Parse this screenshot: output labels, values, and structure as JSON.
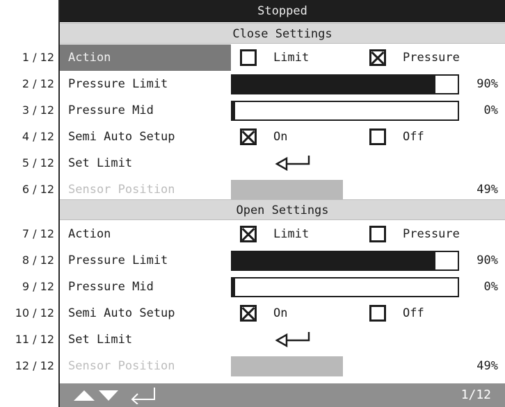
{
  "status": "Stopped",
  "close_section": {
    "title": "Close Settings",
    "rows": [
      {
        "num": "1 / 12",
        "label": "Action",
        "opt1": "Limit",
        "opt1_checked": false,
        "opt2": "Pressure",
        "opt2_checked": true
      },
      {
        "num": "2 / 12",
        "label": "Pressure Limit",
        "value": 90,
        "value_text": "90%"
      },
      {
        "num": "3 / 12",
        "label": "Pressure Mid",
        "value": 0,
        "value_text": "0%"
      },
      {
        "num": "4 / 12",
        "label": "Semi Auto Setup",
        "opt1": "On",
        "opt1_checked": true,
        "opt2": "Off",
        "opt2_checked": false
      },
      {
        "num": "5 / 12",
        "label": "Set Limit"
      },
      {
        "num": "6 / 12",
        "label": "Sensor Position",
        "value": 49,
        "value_text": "49%"
      }
    ]
  },
  "open_section": {
    "title": "Open Settings",
    "rows": [
      {
        "num": "7 / 12",
        "label": "Action",
        "opt1": "Limit",
        "opt1_checked": true,
        "opt2": "Pressure",
        "opt2_checked": false
      },
      {
        "num": "8 / 12",
        "label": "Pressure Limit",
        "value": 90,
        "value_text": "90%"
      },
      {
        "num": "9 / 12",
        "label": "Pressure Mid",
        "value": 0,
        "value_text": "0%"
      },
      {
        "num": "10 / 12",
        "label": "Semi Auto Setup",
        "opt1": "On",
        "opt1_checked": true,
        "opt2": "Off",
        "opt2_checked": false
      },
      {
        "num": "11 / 12",
        "label": "Set Limit"
      },
      {
        "num": "12 / 12",
        "label": "Sensor Position",
        "value": 49,
        "value_text": "49%"
      }
    ]
  },
  "footer": {
    "icons": [
      "up-arrow-icon",
      "down-arrow-icon",
      "enter-icon"
    ],
    "page": "1/12"
  },
  "colors": {
    "title_bg": "#1e1e1e",
    "header_bg": "#d8d8d8",
    "selected_bg": "#7a7a7a",
    "bar_fill": "#1c1c1c",
    "disabled_fill": "#b9b9b9",
    "footer_bg": "#8f8f8f"
  }
}
